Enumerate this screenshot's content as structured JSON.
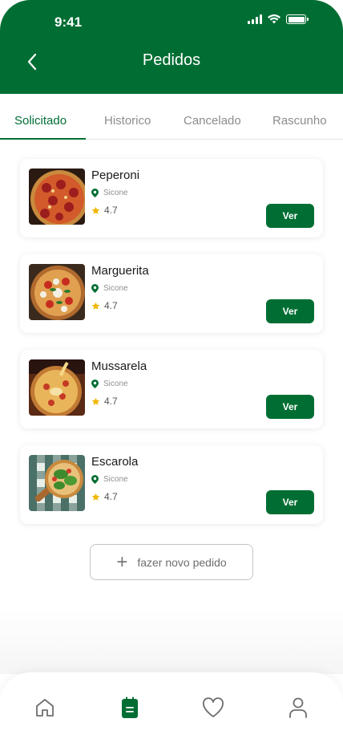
{
  "status_bar": {
    "time": "9:41"
  },
  "header": {
    "title": "Pedidos",
    "back_icon": "chevron-left-icon"
  },
  "tabs": [
    {
      "label": "Solicitado",
      "active": true
    },
    {
      "label": "Historico",
      "active": false
    },
    {
      "label": "Cancelado",
      "active": false
    },
    {
      "label": "Rascunho",
      "active": false
    }
  ],
  "orders": [
    {
      "name": "Peperoni",
      "location": "Sicone",
      "rating": "4.7",
      "action": "Ver"
    },
    {
      "name": "Marguerita",
      "location": "Sicone",
      "rating": "4.7",
      "action": "Ver"
    },
    {
      "name": "Mussarela",
      "location": "Sicone",
      "rating": "4.7",
      "action": "Ver"
    },
    {
      "name": "Escarola",
      "location": "Sicone",
      "rating": "4.7",
      "action": "Ver"
    }
  ],
  "new_order_button": {
    "label": "fazer novo pedido",
    "icon": "plus-icon"
  },
  "bottom_nav": [
    {
      "name": "home",
      "icon": "home-icon",
      "active": false
    },
    {
      "name": "orders",
      "icon": "orders-icon",
      "active": true
    },
    {
      "name": "favorites",
      "icon": "heart-icon",
      "active": false
    },
    {
      "name": "profile",
      "icon": "user-icon",
      "active": false
    }
  ],
  "colors": {
    "primary": "#006e33",
    "star": "#f2b705",
    "muted": "#8c8c8c"
  }
}
